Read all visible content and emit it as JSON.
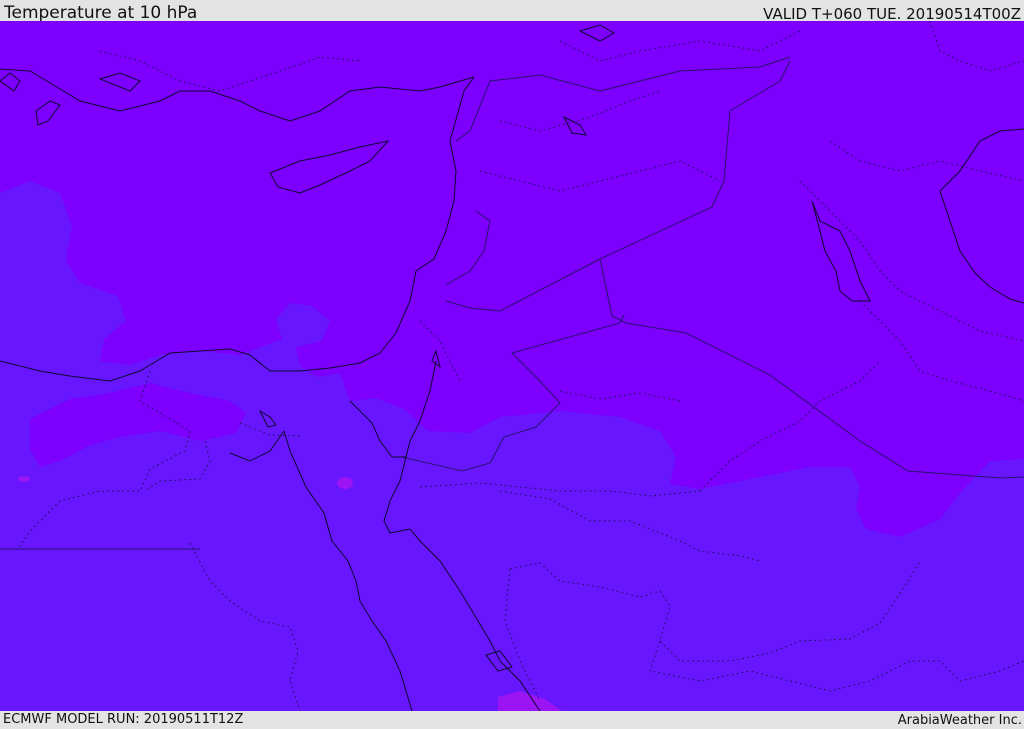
{
  "header": {
    "title": "Temperature at 10 hPa",
    "valid_time": "VALID T+060 TUE. 20190514T00Z"
  },
  "footer": {
    "model_run": "ECMWF MODEL RUN: 20190511T12Z",
    "credit": "ArabiaWeather Inc."
  },
  "map": {
    "colors": {
      "warmer_band": "#7d00fe",
      "cooler_band": "#6716fe",
      "magenta_spots": "#9a14f4",
      "coastline": "#0f0a33",
      "borders": "#2a1270"
    }
  }
}
